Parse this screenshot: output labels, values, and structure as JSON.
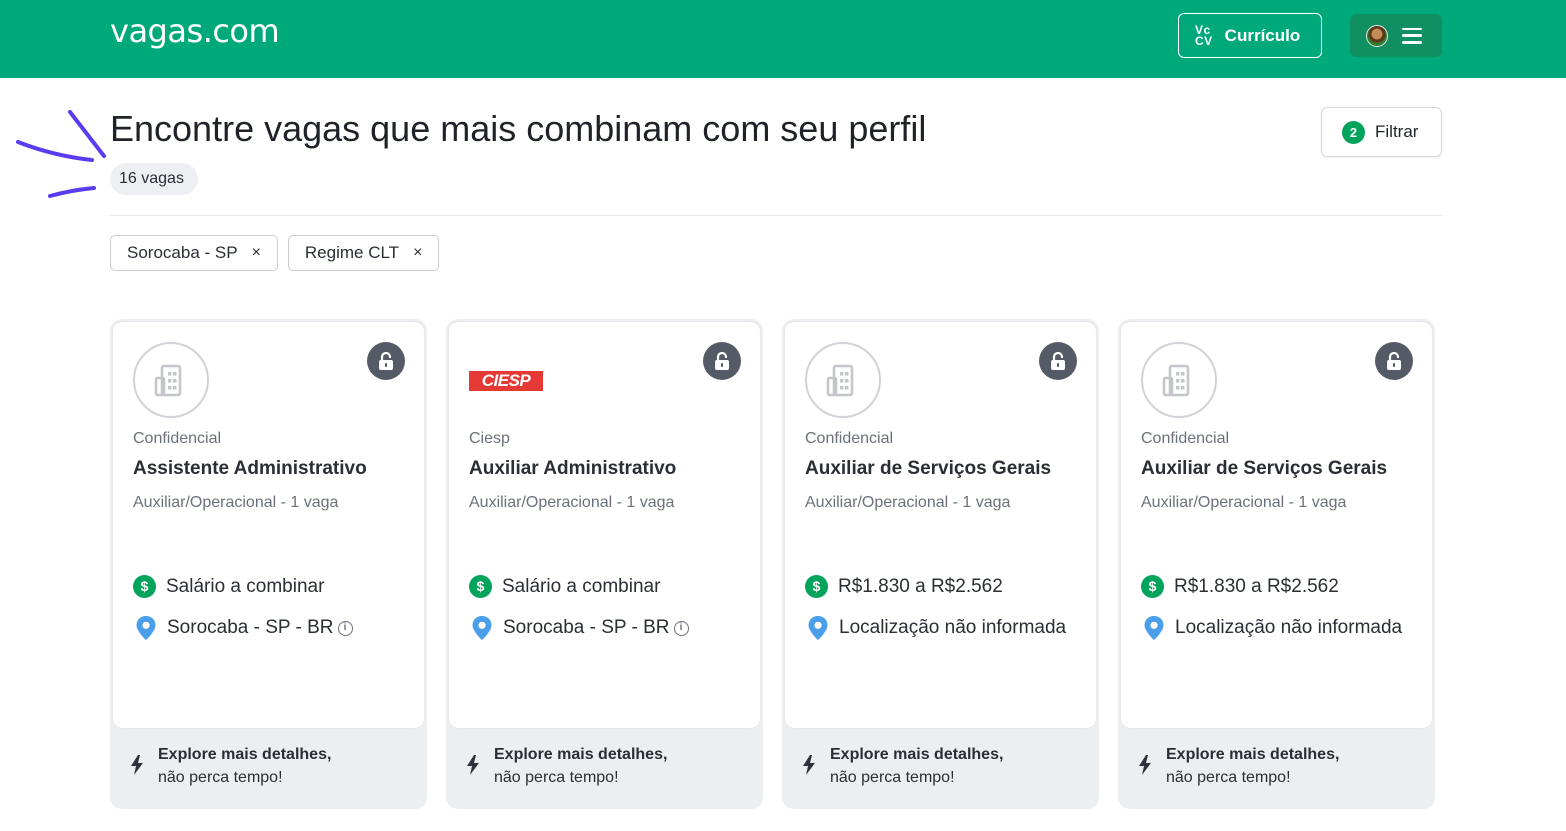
{
  "header": {
    "logo": "vagas.com",
    "cv_icon_top": "Vc",
    "cv_icon_bottom": "CV",
    "cv_button_label": "Currículo"
  },
  "main": {
    "title": "Encontre vagas que mais combinam com seu perfil",
    "count": "16 vagas",
    "filter": {
      "badge": "2",
      "label": "Filtrar"
    },
    "chips": [
      {
        "label": "Sorocaba - SP",
        "remove": "×"
      },
      {
        "label": "Regime CLT",
        "remove": "×"
      }
    ]
  },
  "cards": [
    {
      "logo": "building-icon",
      "company": "Confidencial",
      "title": "Assistente Administrativo",
      "meta": "Auxiliar/Operacional - 1 vaga",
      "salary": "Salário a combinar",
      "location": "Sorocaba - SP - BR",
      "cta_strong": "Explore mais detalhes,",
      "cta_sub": "não perca tempo!"
    },
    {
      "logo_text": "CIESP",
      "company": "Ciesp",
      "title": "Auxiliar Administrativo",
      "meta": "Auxiliar/Operacional - 1 vaga",
      "salary": "Salário a combinar",
      "location": "Sorocaba - SP - BR",
      "cta_strong": "Explore mais detalhes,",
      "cta_sub": "não perca tempo!"
    },
    {
      "logo": "building-icon",
      "company": "Confidencial",
      "title": "Auxiliar de Serviços Gerais",
      "meta": "Auxiliar/Operacional - 1 vaga",
      "salary": "R$1.830 a R$2.562",
      "location": "Localização não informada",
      "cta_strong": "Explore mais detalhes,",
      "cta_sub": "não perca tempo!"
    },
    {
      "logo": "building-icon",
      "company": "Confidencial",
      "title": "Auxiliar de Serviços Gerais",
      "meta": "Auxiliar/Operacional - 1 vaga",
      "salary": "R$1.830 a R$2.562",
      "location": "Localização não informada",
      "cta_strong": "Explore mais detalhes,",
      "cta_sub": "não perca tempo!"
    }
  ],
  "colors": {
    "brand": "#00a97a",
    "accent_green": "#00a35c",
    "pin_blue": "#4a9fe8",
    "lock_gray": "#555b66",
    "annotation_purple": "#5b3bf0"
  },
  "icons": [
    "menu-icon",
    "avatar",
    "lock-icon",
    "dollar-icon",
    "pin-icon",
    "info-icon",
    "bolt-icon",
    "close-icon"
  ]
}
